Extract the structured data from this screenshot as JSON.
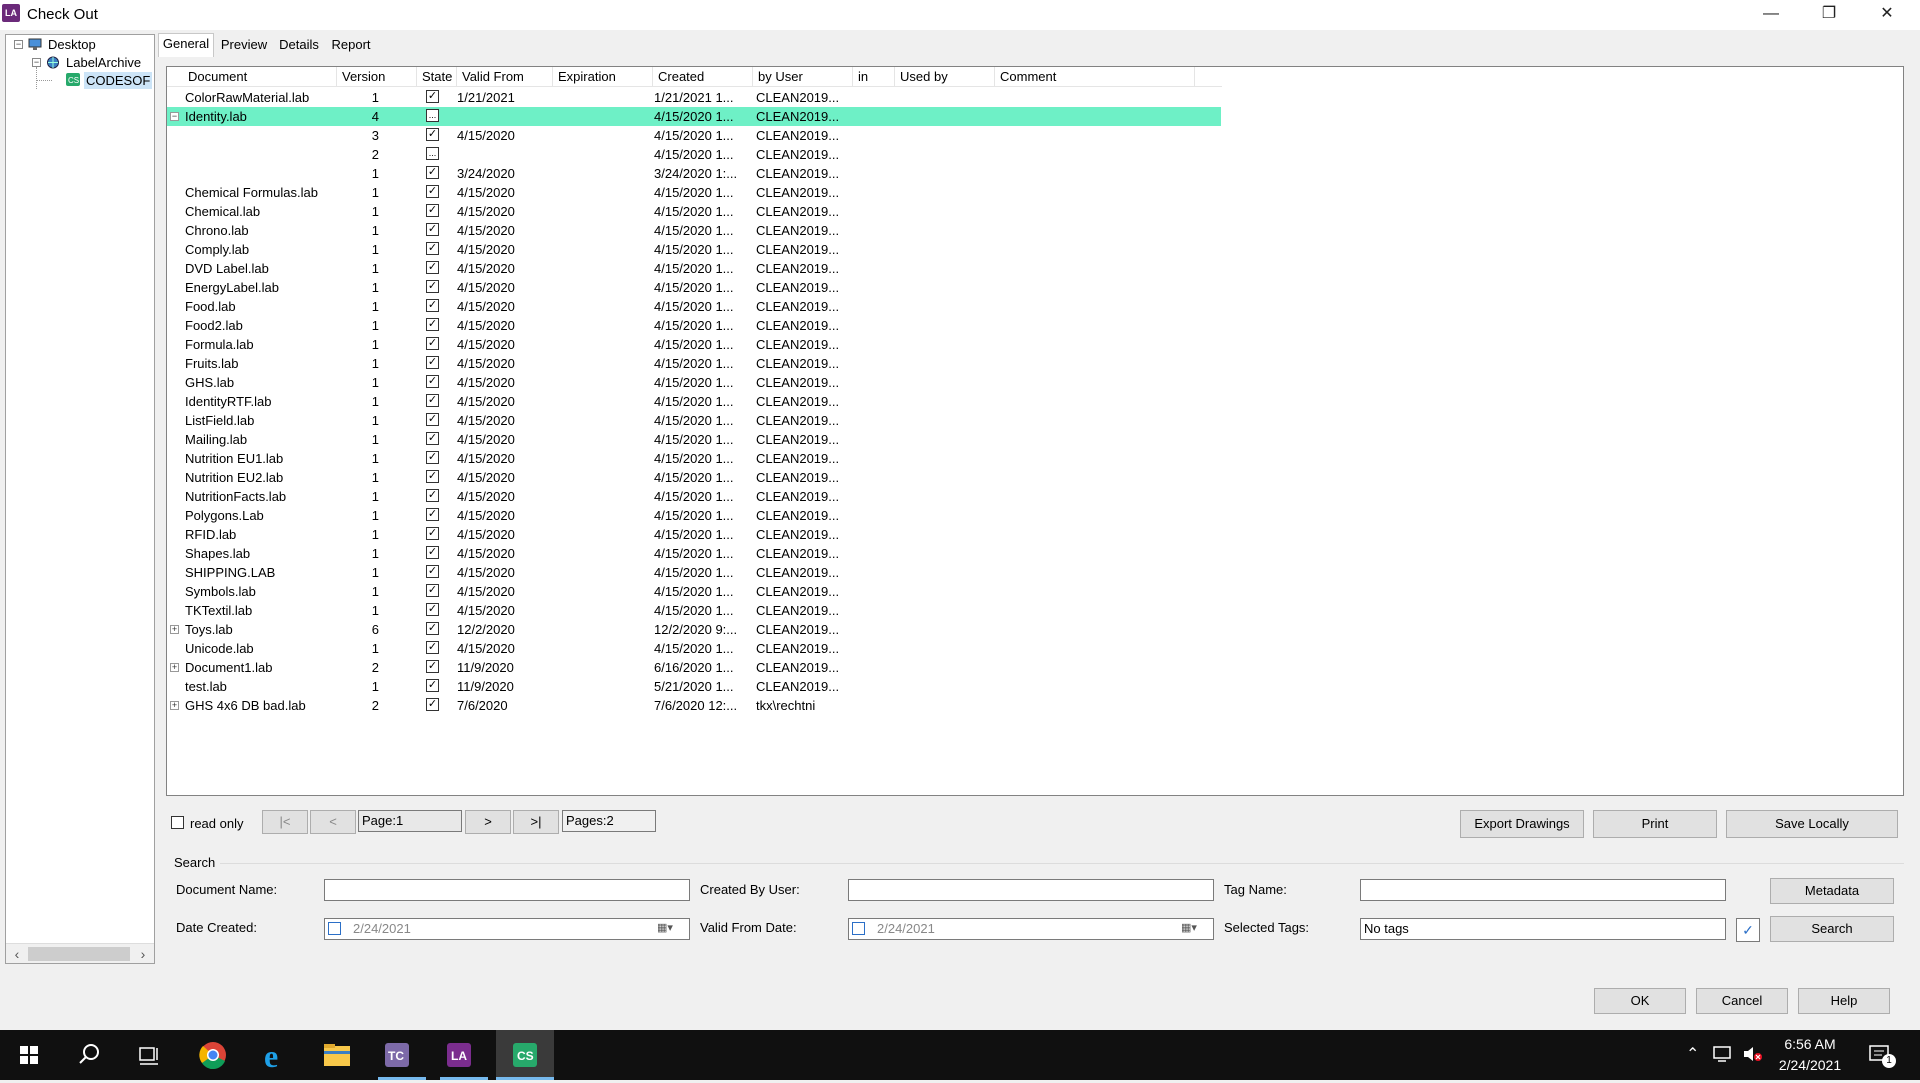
{
  "window": {
    "title": "Check Out",
    "app_icon": "LA"
  },
  "tree": {
    "items": [
      {
        "label": "Desktop",
        "icon": "desktop-icon"
      },
      {
        "label": "LabelArchive",
        "icon": "globe-icon"
      },
      {
        "label": "CODESOF",
        "icon": "cs-icon"
      }
    ]
  },
  "tabs": [
    "General",
    "Preview",
    "Details",
    "Report"
  ],
  "grid": {
    "columns": [
      "Document",
      "Version",
      "State",
      "Valid From",
      "Expiration",
      "Created",
      "by User",
      "in",
      "Used by",
      "Comment"
    ],
    "rows": [
      {
        "expander": "",
        "doc": "ColorRawMaterial.lab",
        "ver": "1",
        "state": "check",
        "valid": "1/21/2021",
        "created": "1/21/2021 1...",
        "user": "CLEAN2019..."
      },
      {
        "expander": "minus",
        "doc": "Identity.lab",
        "ver": "4",
        "state": "dots",
        "valid": "",
        "created": "4/15/2020 1...",
        "user": "CLEAN2019...",
        "selected": true
      },
      {
        "expander": "",
        "doc": "",
        "ver": "3",
        "state": "check",
        "valid": "4/15/2020",
        "created": "4/15/2020 1...",
        "user": "CLEAN2019..."
      },
      {
        "expander": "",
        "doc": "",
        "ver": "2",
        "state": "dots",
        "valid": "",
        "created": "4/15/2020 1...",
        "user": "CLEAN2019..."
      },
      {
        "expander": "",
        "doc": "",
        "ver": "1",
        "state": "check",
        "valid": "3/24/2020",
        "created": "3/24/2020 1:...",
        "user": "CLEAN2019..."
      },
      {
        "expander": "",
        "doc": "Chemical Formulas.lab",
        "ver": "1",
        "state": "check",
        "valid": "4/15/2020",
        "created": "4/15/2020 1...",
        "user": "CLEAN2019..."
      },
      {
        "expander": "",
        "doc": "Chemical.lab",
        "ver": "1",
        "state": "check",
        "valid": "4/15/2020",
        "created": "4/15/2020 1...",
        "user": "CLEAN2019..."
      },
      {
        "expander": "",
        "doc": "Chrono.lab",
        "ver": "1",
        "state": "check",
        "valid": "4/15/2020",
        "created": "4/15/2020 1...",
        "user": "CLEAN2019..."
      },
      {
        "expander": "",
        "doc": "Comply.lab",
        "ver": "1",
        "state": "check",
        "valid": "4/15/2020",
        "created": "4/15/2020 1...",
        "user": "CLEAN2019..."
      },
      {
        "expander": "",
        "doc": "DVD Label.lab",
        "ver": "1",
        "state": "check",
        "valid": "4/15/2020",
        "created": "4/15/2020 1...",
        "user": "CLEAN2019..."
      },
      {
        "expander": "",
        "doc": "EnergyLabel.lab",
        "ver": "1",
        "state": "check",
        "valid": "4/15/2020",
        "created": "4/15/2020 1...",
        "user": "CLEAN2019..."
      },
      {
        "expander": "",
        "doc": "Food.lab",
        "ver": "1",
        "state": "check",
        "valid": "4/15/2020",
        "created": "4/15/2020 1...",
        "user": "CLEAN2019..."
      },
      {
        "expander": "",
        "doc": "Food2.lab",
        "ver": "1",
        "state": "check",
        "valid": "4/15/2020",
        "created": "4/15/2020 1...",
        "user": "CLEAN2019..."
      },
      {
        "expander": "",
        "doc": "Formula.lab",
        "ver": "1",
        "state": "check",
        "valid": "4/15/2020",
        "created": "4/15/2020 1...",
        "user": "CLEAN2019..."
      },
      {
        "expander": "",
        "doc": "Fruits.lab",
        "ver": "1",
        "state": "check",
        "valid": "4/15/2020",
        "created": "4/15/2020 1...",
        "user": "CLEAN2019..."
      },
      {
        "expander": "",
        "doc": "GHS.lab",
        "ver": "1",
        "state": "check",
        "valid": "4/15/2020",
        "created": "4/15/2020 1...",
        "user": "CLEAN2019..."
      },
      {
        "expander": "",
        "doc": "IdentityRTF.lab",
        "ver": "1",
        "state": "check",
        "valid": "4/15/2020",
        "created": "4/15/2020 1...",
        "user": "CLEAN2019..."
      },
      {
        "expander": "",
        "doc": "ListField.lab",
        "ver": "1",
        "state": "check",
        "valid": "4/15/2020",
        "created": "4/15/2020 1...",
        "user": "CLEAN2019..."
      },
      {
        "expander": "",
        "doc": "Mailing.lab",
        "ver": "1",
        "state": "check",
        "valid": "4/15/2020",
        "created": "4/15/2020 1...",
        "user": "CLEAN2019..."
      },
      {
        "expander": "",
        "doc": "Nutrition  EU1.lab",
        "ver": "1",
        "state": "check",
        "valid": "4/15/2020",
        "created": "4/15/2020 1...",
        "user": "CLEAN2019..."
      },
      {
        "expander": "",
        "doc": "Nutrition  EU2.lab",
        "ver": "1",
        "state": "check",
        "valid": "4/15/2020",
        "created": "4/15/2020 1...",
        "user": "CLEAN2019..."
      },
      {
        "expander": "",
        "doc": "NutritionFacts.lab",
        "ver": "1",
        "state": "check",
        "valid": "4/15/2020",
        "created": "4/15/2020 1...",
        "user": "CLEAN2019..."
      },
      {
        "expander": "",
        "doc": "Polygons.Lab",
        "ver": "1",
        "state": "check",
        "valid": "4/15/2020",
        "created": "4/15/2020 1...",
        "user": "CLEAN2019..."
      },
      {
        "expander": "",
        "doc": "RFID.lab",
        "ver": "1",
        "state": "check",
        "valid": "4/15/2020",
        "created": "4/15/2020 1...",
        "user": "CLEAN2019..."
      },
      {
        "expander": "",
        "doc": "Shapes.lab",
        "ver": "1",
        "state": "check",
        "valid": "4/15/2020",
        "created": "4/15/2020 1...",
        "user": "CLEAN2019..."
      },
      {
        "expander": "",
        "doc": "SHIPPING.LAB",
        "ver": "1",
        "state": "check",
        "valid": "4/15/2020",
        "created": "4/15/2020 1...",
        "user": "CLEAN2019..."
      },
      {
        "expander": "",
        "doc": "Symbols.lab",
        "ver": "1",
        "state": "check",
        "valid": "4/15/2020",
        "created": "4/15/2020 1...",
        "user": "CLEAN2019..."
      },
      {
        "expander": "",
        "doc": "TKTextil.lab",
        "ver": "1",
        "state": "check",
        "valid": "4/15/2020",
        "created": "4/15/2020 1...",
        "user": "CLEAN2019..."
      },
      {
        "expander": "plus",
        "doc": "Toys.lab",
        "ver": "6",
        "state": "check",
        "valid": "12/2/2020",
        "created": "12/2/2020 9:...",
        "user": "CLEAN2019..."
      },
      {
        "expander": "",
        "doc": "Unicode.lab",
        "ver": "1",
        "state": "check",
        "valid": "4/15/2020",
        "created": "4/15/2020 1...",
        "user": "CLEAN2019..."
      },
      {
        "expander": "plus",
        "doc": "Document1.lab",
        "ver": "2",
        "state": "check",
        "valid": "11/9/2020",
        "created": "6/16/2020 1...",
        "user": "CLEAN2019..."
      },
      {
        "expander": "",
        "doc": "test.lab",
        "ver": "1",
        "state": "check",
        "valid": "11/9/2020",
        "created": "5/21/2020 1...",
        "user": "CLEAN2019..."
      },
      {
        "expander": "plus",
        "doc": "GHS 4x6 DB bad.lab",
        "ver": "2",
        "state": "check",
        "valid": "7/6/2020",
        "created": "7/6/2020 12:...",
        "user": "tkx\\rechtni"
      }
    ]
  },
  "pager": {
    "read_only_label": "read only",
    "first": "|<",
    "prev": "<",
    "page": "Page:1",
    "next": ">",
    "last": ">|",
    "pages": "Pages:2"
  },
  "actions": {
    "export": "Export Drawings",
    "print": "Print",
    "save": "Save Locally"
  },
  "search": {
    "title": "Search",
    "doc_name_label": "Document Name:",
    "doc_name_value": "",
    "created_by_label": "Created By User:",
    "created_by_value": "",
    "tag_name_label": "Tag Name:",
    "tag_name_value": "",
    "metadata": "Metadata",
    "date_created_label": "Date Created:",
    "date_created_value": "2/24/2021",
    "valid_from_label": "Valid From Date:",
    "valid_from_value": "2/24/2021",
    "selected_tags_label": "Selected Tags:",
    "selected_tags_value": "No tags",
    "search_button": "Search"
  },
  "dialog": {
    "ok": "OK",
    "cancel": "Cancel",
    "help": "Help"
  },
  "taskbar": {
    "apps": [
      "start-icon",
      "search-icon",
      "task-view-icon",
      "chrome-icon",
      "ie-icon",
      "file-explorer-icon",
      "tc-icon",
      "la-icon",
      "cs-icon"
    ],
    "tc_label": "TC",
    "la_label": "LA",
    "cs_label": "CS",
    "time": "6:56 AM",
    "date": "2/24/2021",
    "notif_count": "1"
  },
  "colors": {
    "selection": "#6ef0c6",
    "taskbar": "#101010",
    "accent": "#76b9ed"
  }
}
